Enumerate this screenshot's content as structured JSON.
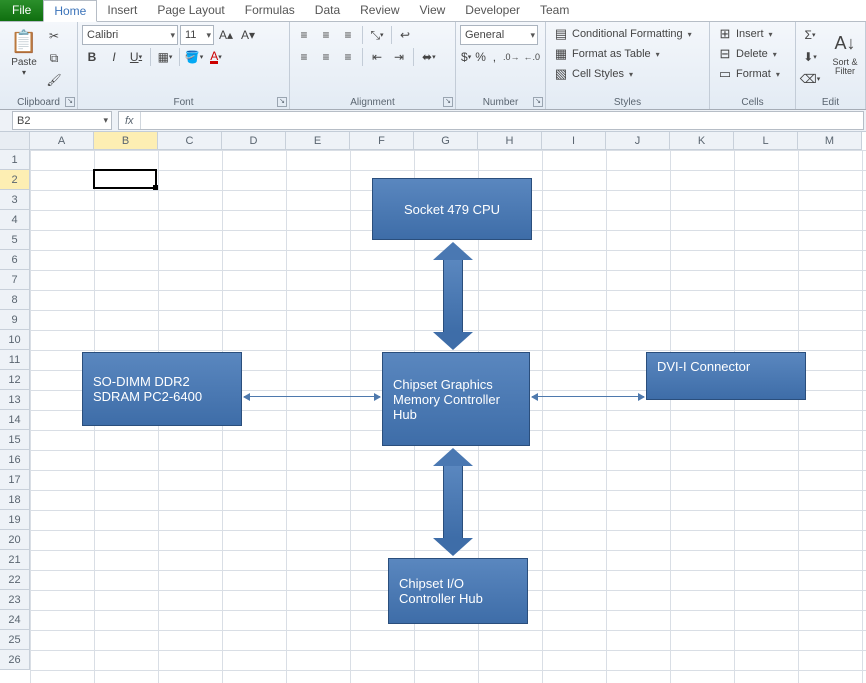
{
  "tabs": {
    "file": "File",
    "home": "Home",
    "insert": "Insert",
    "page": "Page Layout",
    "formulas": "Formulas",
    "data": "Data",
    "review": "Review",
    "view": "View",
    "developer": "Developer",
    "team": "Team"
  },
  "ribbon": {
    "clipboard": {
      "label": "Clipboard",
      "paste": "Paste"
    },
    "font": {
      "label": "Font",
      "name": "Calibri",
      "size": "11"
    },
    "alignment": {
      "label": "Alignment"
    },
    "number": {
      "label": "Number",
      "format": "General"
    },
    "styles": {
      "label": "Styles",
      "cond": "Conditional Formatting",
      "table": "Format as Table",
      "cell": "Cell Styles"
    },
    "cells": {
      "label": "Cells",
      "insert": "Insert",
      "delete": "Delete",
      "format": "Format"
    },
    "editing": {
      "label": "Edit",
      "sort": "Sort & Filter"
    }
  },
  "namebox": "B2",
  "formula": "",
  "columns": [
    "A",
    "B",
    "C",
    "D",
    "E",
    "F",
    "G",
    "H",
    "I",
    "J",
    "K",
    "L",
    "M"
  ],
  "rows": [
    "1",
    "2",
    "3",
    "4",
    "5",
    "6",
    "7",
    "8",
    "9",
    "10",
    "11",
    "12",
    "13",
    "14",
    "15",
    "16",
    "17",
    "18",
    "19",
    "20",
    "21",
    "22",
    "23",
    "24",
    "25",
    "26"
  ],
  "active": {
    "col": "B",
    "row": "2"
  },
  "diagram": {
    "cpu": "Socket 479 CPU",
    "sodimm": "SO-DIMM DDR2 SDRAM PC2-6400",
    "gmch": "Chipset Graphics Memory Controller Hub",
    "dvi": "DVI-I Connector",
    "ich": "Chipset I/O Controller Hub"
  }
}
